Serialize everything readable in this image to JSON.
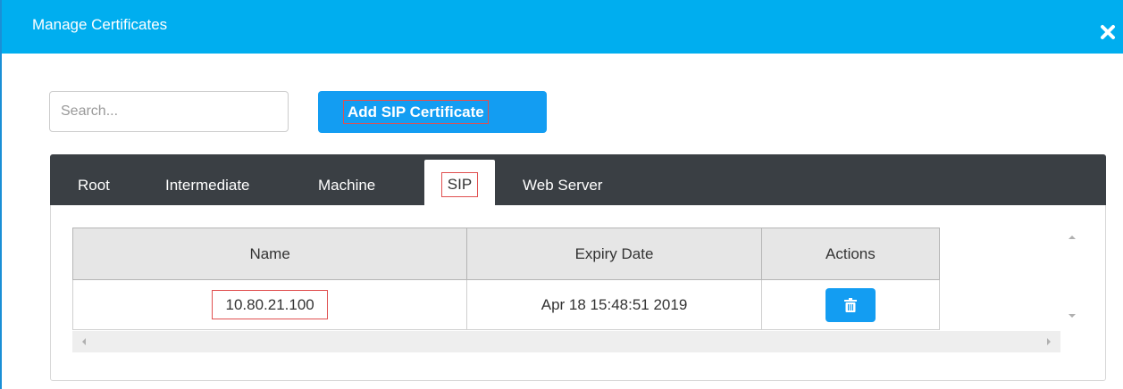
{
  "dialog": {
    "title": "Manage Certificates",
    "close_icon": "close-icon"
  },
  "toolbar": {
    "search_placeholder": "Search...",
    "add_button_label": "Add SIP Certificate"
  },
  "tabs": [
    {
      "label": "Root",
      "active": false
    },
    {
      "label": "Intermediate",
      "active": false
    },
    {
      "label": "Machine",
      "active": false
    },
    {
      "label": "SIP",
      "active": true
    },
    {
      "label": "Web Server",
      "active": false
    }
  ],
  "table": {
    "columns": [
      "Name",
      "Expiry Date",
      "Actions"
    ],
    "rows": [
      {
        "name": "10.80.21.100",
        "expiry": "Apr 18 15:48:51 2019",
        "action_icon": "trash-icon"
      }
    ]
  },
  "colors": {
    "header": "#00aeef",
    "button": "#139df2",
    "tabbar": "#3a3f44",
    "highlight": "#e05050"
  }
}
